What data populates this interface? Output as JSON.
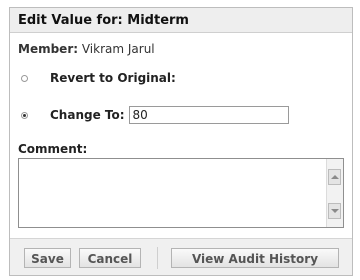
{
  "dialog": {
    "title": "Edit Value for: Midterm",
    "member_label": "Member:",
    "member_name": "Vikram Jarul"
  },
  "options": {
    "revert_label": "Revert to Original:",
    "change_label": "Change To:",
    "change_value": "80",
    "selected": "change"
  },
  "comment": {
    "label": "Comment:",
    "value": ""
  },
  "buttons": {
    "save": "Save",
    "cancel": "Cancel",
    "audit": "View Audit History"
  }
}
